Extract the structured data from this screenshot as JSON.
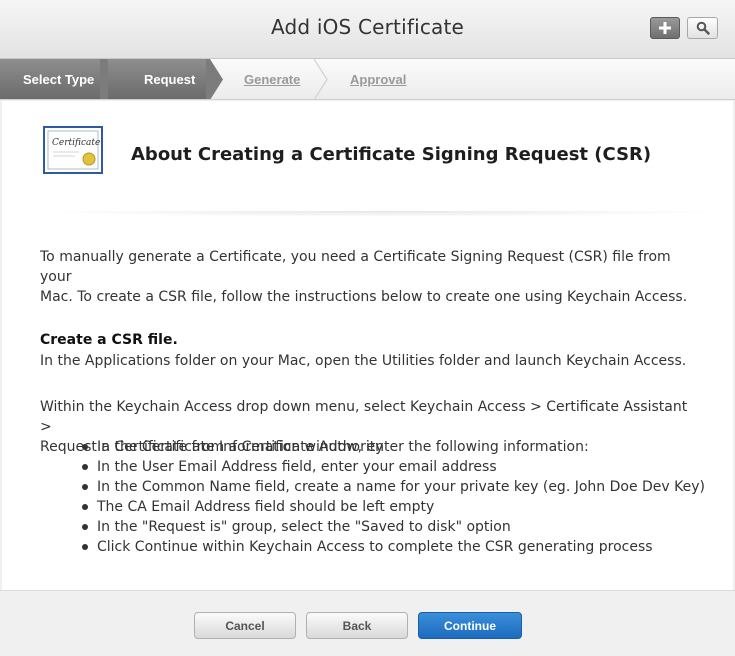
{
  "window": {
    "title": "Add iOS Certificate"
  },
  "header": {
    "add_icon": "plus-icon",
    "search_icon": "search-icon"
  },
  "steps": [
    {
      "label": "Select Type",
      "state": "done"
    },
    {
      "label": "Request",
      "state": "current"
    },
    {
      "label": "Generate",
      "state": "pending"
    },
    {
      "label": "Approval",
      "state": "pending"
    }
  ],
  "about": {
    "icon": "certificate-icon",
    "certificate_text": "Certificate",
    "title": "About Creating a Certificate Signing Request (CSR)"
  },
  "content": {
    "intro_line1": "To manually generate a Certificate, you need a Certificate Signing Request (CSR) file from your",
    "intro_line2": "Mac. To create a CSR file, follow the instructions below to create one using Keychain Access.",
    "csr_heading": "Create a CSR file.",
    "csr_line": "In the Applications folder on your Mac, open the Utilities folder and launch Keychain Access.",
    "keychain_line1": "Within the Keychain Access drop down menu, select Keychain Access > Certificate Assistant >",
    "keychain_line2": "Request a Certificate from a Certificate Authority",
    "bullets": [
      "In the Certificate Information window, enter the following information:",
      "In the User Email Address field, enter your email address",
      "In the Common Name field, create a name for your private key (eg. John Doe Dev Key)",
      "The CA Email Address field should be left empty",
      "In the \"Request is\" group, select the \"Saved to disk\" option",
      "Click Continue within Keychain Access to complete the CSR generating process"
    ]
  },
  "footer": {
    "cancel_label": "Cancel",
    "back_label": "Back",
    "continue_label": "Continue"
  },
  "colors": {
    "accent": "#1c6bc0",
    "step_done": "#7a7a7a",
    "step_pending_text": "#9a9a9a"
  }
}
